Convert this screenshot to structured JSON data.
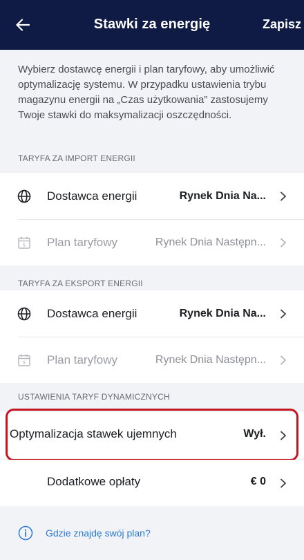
{
  "header": {
    "title": "Stawki za energię",
    "save_label": "Zapisz"
  },
  "intro_text": "Wybierz dostawcę energii i plan taryfowy, aby umożliwić optymalizację systemu. W przypadku ustawienia trybu magazynu energii na „Czas użytkowania” zastosujemy Twoje stawki do maksymalizacji oszczędności.",
  "import": {
    "section_title": "TARYFA ZA IMPORT ENERGII",
    "provider_label": "Dostawca energii",
    "provider_value": "Rynek Dnia Na...",
    "plan_label": "Plan taryfowy",
    "plan_value": "Rynek Dnia Następn..."
  },
  "export": {
    "section_title": "TARYFA ZA EKSPORT ENERGII",
    "provider_label": "Dostawca energii",
    "provider_value": "Rynek Dnia Na...",
    "plan_label": "Plan taryfowy",
    "plan_value": "Rynek Dnia Następn..."
  },
  "dynamic": {
    "section_title": "USTAWIENIA TARYF DYNAMICZNYCH",
    "negative_label": "Optymalizacja stawek ujemnych",
    "negative_value": "Wył.",
    "fees_label": "Dodatkowe opłaty",
    "fees_value": "€ 0"
  },
  "help": {
    "text": "Gdzie znajdę swój plan?"
  },
  "colors": {
    "header_bg": "#0f1a45",
    "highlight": "#c4141f",
    "link": "#2a7bd6"
  }
}
